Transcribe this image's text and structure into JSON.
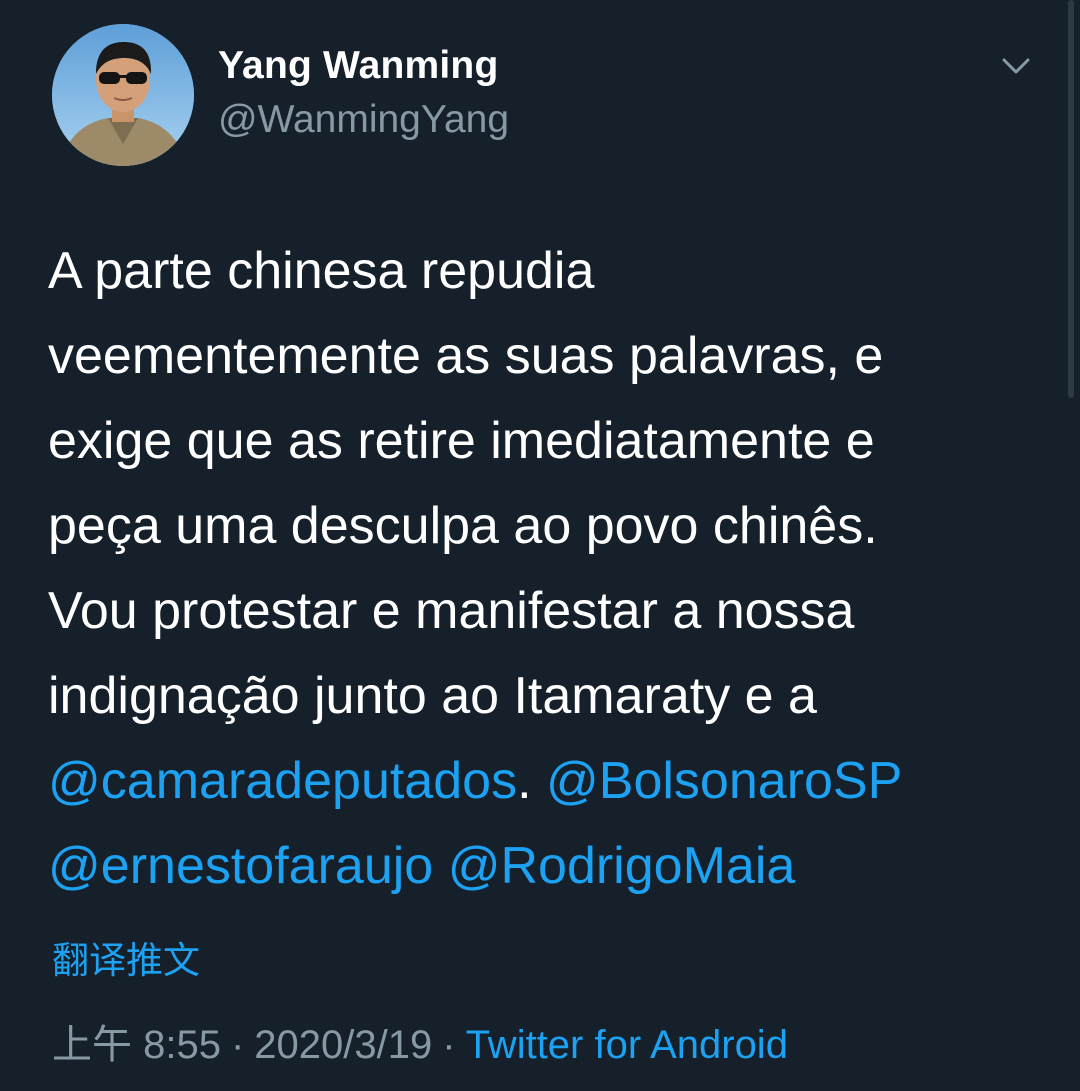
{
  "author": {
    "name": "Yang Wanming",
    "handle": "@WanmingYang"
  },
  "icons": {
    "avatar": "profile-photo",
    "menu": "chevron-down-icon"
  },
  "tweet": {
    "lines": [
      {
        "segments": [
          {
            "text": "A parte chinesa repudia",
            "mention": false
          }
        ]
      },
      {
        "segments": [
          {
            "text": "veementemente as suas palavras, e",
            "mention": false
          }
        ]
      },
      {
        "segments": [
          {
            "text": "exige que as retire imediatamente e",
            "mention": false
          }
        ]
      },
      {
        "segments": [
          {
            "text": "peça uma desculpa ao povo chinês.",
            "mention": false
          }
        ]
      },
      {
        "segments": [
          {
            "text": "Vou protestar e manifestar a nossa",
            "mention": false
          }
        ]
      },
      {
        "segments": [
          {
            "text": "indignação junto ao Itamaraty e a",
            "mention": false
          }
        ]
      },
      {
        "segments": [
          {
            "text": "@camaradeputados",
            "mention": true
          },
          {
            "text": ". ",
            "mention": false
          },
          {
            "text": "@BolsonaroSP",
            "mention": true
          }
        ]
      },
      {
        "segments": [
          {
            "text": "@ernestofaraujo",
            "mention": true
          },
          {
            "text": " ",
            "mention": false
          },
          {
            "text": "@RodrigoMaia",
            "mention": true
          }
        ]
      }
    ]
  },
  "translate_label": "翻译推文",
  "meta": {
    "time": "上午 8:55",
    "separator": "·",
    "date": "2020/3/19",
    "source": "Twitter for Android"
  },
  "colors": {
    "background": "#15202b",
    "text": "#ffffff",
    "secondary": "#8899a6",
    "accent": "#1da1f2"
  }
}
